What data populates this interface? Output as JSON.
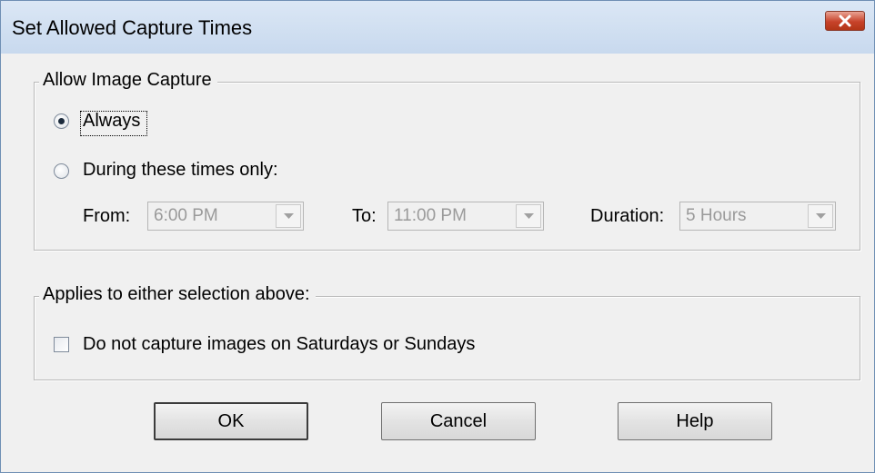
{
  "window": {
    "title": "Set Allowed Capture Times",
    "close_icon": "close-icon"
  },
  "capture_group": {
    "legend": "Allow Image Capture",
    "always_label": "Always",
    "always_selected": true,
    "during_label": "During these times only:",
    "during_selected": false,
    "from_label": "From:",
    "from_value": "6:00 PM",
    "to_label": "To:",
    "to_value": "11:00 PM",
    "duration_label": "Duration:",
    "duration_value": "5 Hours"
  },
  "applies_group": {
    "legend": "Applies to either selection above:",
    "weekend_label": "Do not capture images on Saturdays or Sundays",
    "weekend_checked": false
  },
  "buttons": {
    "ok": "OK",
    "cancel": "Cancel",
    "help": "Help"
  }
}
